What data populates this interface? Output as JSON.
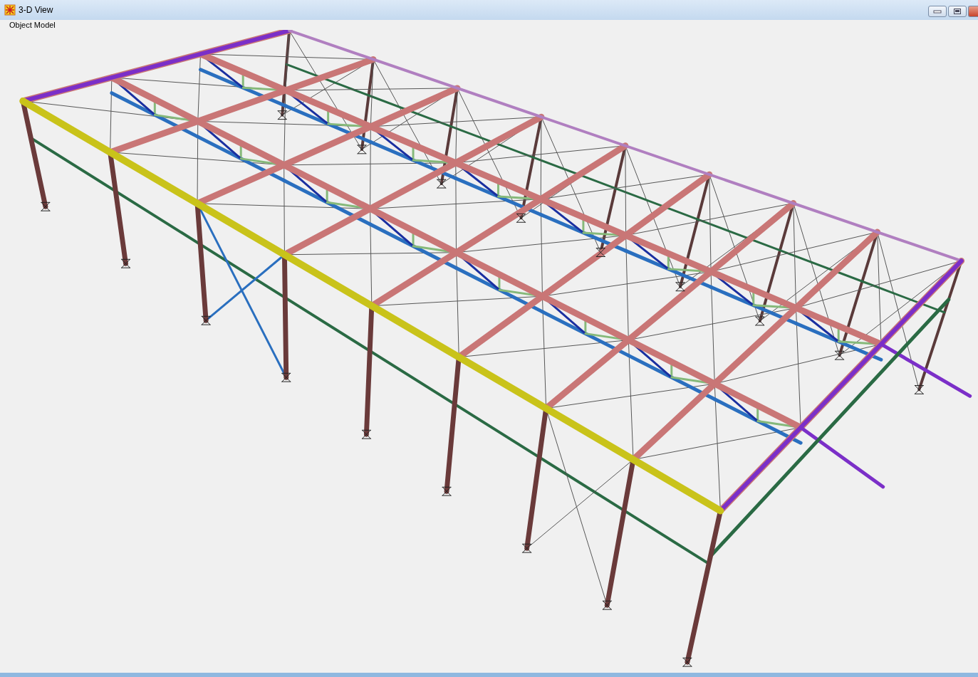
{
  "window": {
    "title": "3-D View"
  },
  "view": {
    "label": "Object Model"
  }
}
